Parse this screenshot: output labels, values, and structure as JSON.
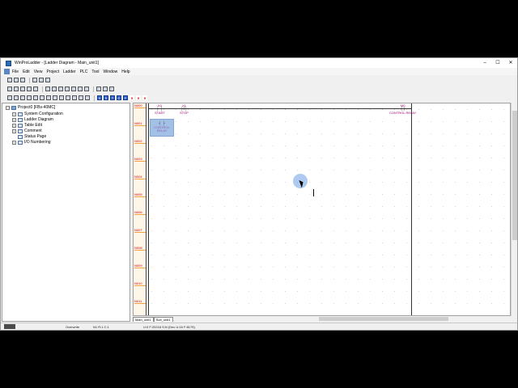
{
  "window": {
    "title": "WinProLadder - [Ladder Diagram - Main_unit1]",
    "controls": [
      "–",
      "☐",
      "✕"
    ]
  },
  "menu": [
    "File",
    "Edit",
    "View",
    "Project",
    "Ladder",
    "PLC",
    "Tool",
    "Window",
    "Help"
  ],
  "toolbar3_labels": [
    "S",
    "S",
    "T",
    "C",
    "F",
    "✕",
    "✕",
    "✕"
  ],
  "tree": {
    "root": "Project0 [FBs-40MC]",
    "items": [
      {
        "label": "System Configuration",
        "expander": "+"
      },
      {
        "label": "Ladder Diagram",
        "expander": "+"
      },
      {
        "label": "Table Edit",
        "expander": "+"
      },
      {
        "label": "Comment",
        "expander": "+"
      },
      {
        "label": "Status Page",
        "expander": ""
      },
      {
        "label": "I/O Numbering",
        "expander": "+"
      }
    ]
  },
  "ladder": {
    "rungs": [
      "N000",
      "N001",
      "N002",
      "N003",
      "N004",
      "N005",
      "N006",
      "N007",
      "N008",
      "N009",
      "N010",
      "N011"
    ],
    "contacts": [
      {
        "name": "X0",
        "symbol": "┤ ├",
        "comment": "START"
      },
      {
        "name": "X1",
        "symbol": "┤/├",
        "comment": "STOP"
      }
    ],
    "coil": {
      "name": "M0",
      "symbol": "( )",
      "comment": "CONTROL RELAY"
    },
    "selected_cell": {
      "symbol": "┤ ├",
      "comment": "CONTROL RELAY"
    }
  },
  "tabs": [
    "Main_unit1",
    "Sub_unit1"
  ],
  "status": {
    "mode": "Overwrite",
    "position": "N1 R:1 C:1",
    "unit": "U:0 F:20218 S:N (Dec U:16 F:8175)"
  }
}
